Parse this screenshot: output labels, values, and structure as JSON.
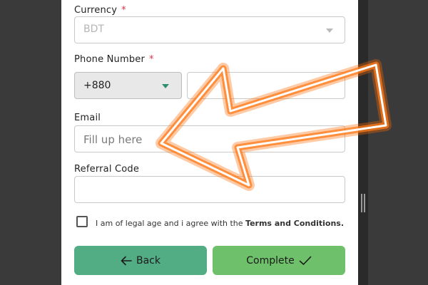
{
  "form": {
    "currency": {
      "label": "Currency",
      "required_mark": "*",
      "value": "BDT"
    },
    "phone": {
      "label": "Phone Number",
      "required_mark": "*",
      "country_code": "+880",
      "value": ""
    },
    "email": {
      "label": "Email",
      "placeholder": "Fill up here",
      "value": ""
    },
    "referral": {
      "label": "Referral Code",
      "value": ""
    },
    "terms": {
      "checked": false,
      "text": "I am of legal age and i agree with the",
      "link": "Terms and Conditions."
    },
    "buttons": {
      "back": "Back",
      "complete": "Complete"
    }
  },
  "icons": {
    "back": "arrow-left-icon",
    "complete": "checkmark-icon",
    "dropdown": "chevron-down-icon",
    "overlay": "glowing-arrow-icon"
  },
  "colors": {
    "back_button": "#52ad84",
    "complete_button": "#6fc06a",
    "required": "#e0334b",
    "country_caret": "#2e8f6a",
    "arrow_glow": "#ff7a1a"
  }
}
